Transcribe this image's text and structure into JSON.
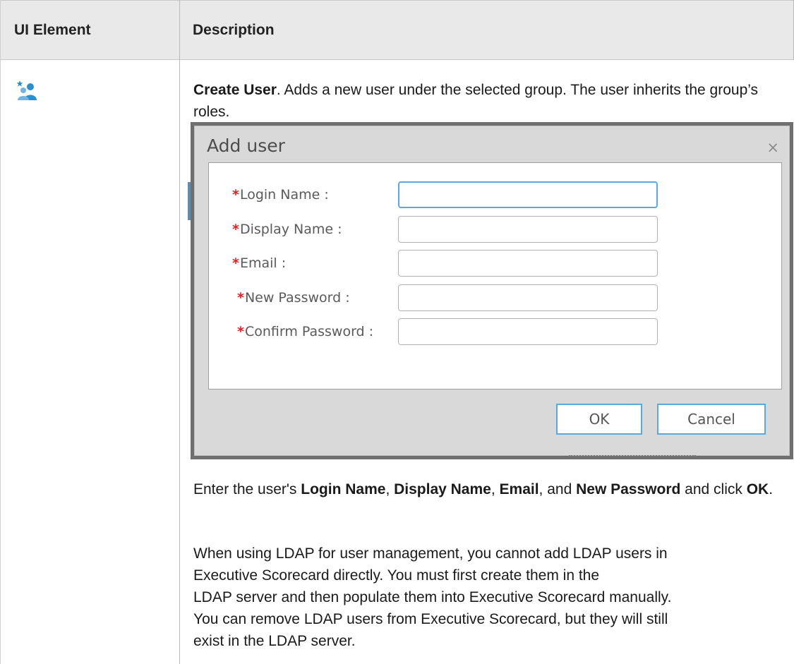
{
  "header": {
    "col1": "UI Element",
    "col2": "Description"
  },
  "row": {
    "icon": "create-user-icon",
    "intro_bold": "Create User",
    "intro_rest": ". Adds a new user under the selected group. The user inherits the group’s roles.",
    "dialog": {
      "title": "Add user",
      "close": "×",
      "fields": [
        {
          "label": "Login Name :",
          "value": ""
        },
        {
          "label": "Display Name :",
          "value": ""
        },
        {
          "label": "Email :",
          "value": ""
        },
        {
          "label": "New Password :",
          "value": ""
        },
        {
          "label": "Confirm Password :",
          "value": ""
        }
      ],
      "required_mark": "*",
      "ok": "OK",
      "cancel": "Cancel"
    },
    "enter": {
      "t1": "Enter the user's ",
      "b1": "Login Name",
      "t2": ", ",
      "b2": "Display Name",
      "t3": ", ",
      "b3": "Email",
      "t4": ", and ",
      "b4": "New Password",
      "t5": " and click ",
      "b5": "OK",
      "t6": "."
    },
    "ldap": {
      "line1": "When using LDAP for user management, you cannot add LDAP users in",
      "line2": "Executive Scorecard directly. You must first create them in the",
      "line3": "LDAP server and then populate them into Executive Scorecard manually.",
      "line4": "You can remove LDAP users from Executive Scorecard, but they will still",
      "line5": "exist in the LDAP server."
    }
  },
  "colors": {
    "header_bg": "#e9e9e9",
    "focus_blue": "#5aa9de",
    "required_red": "#e02020",
    "icon_blue": "#2a8fd0"
  }
}
